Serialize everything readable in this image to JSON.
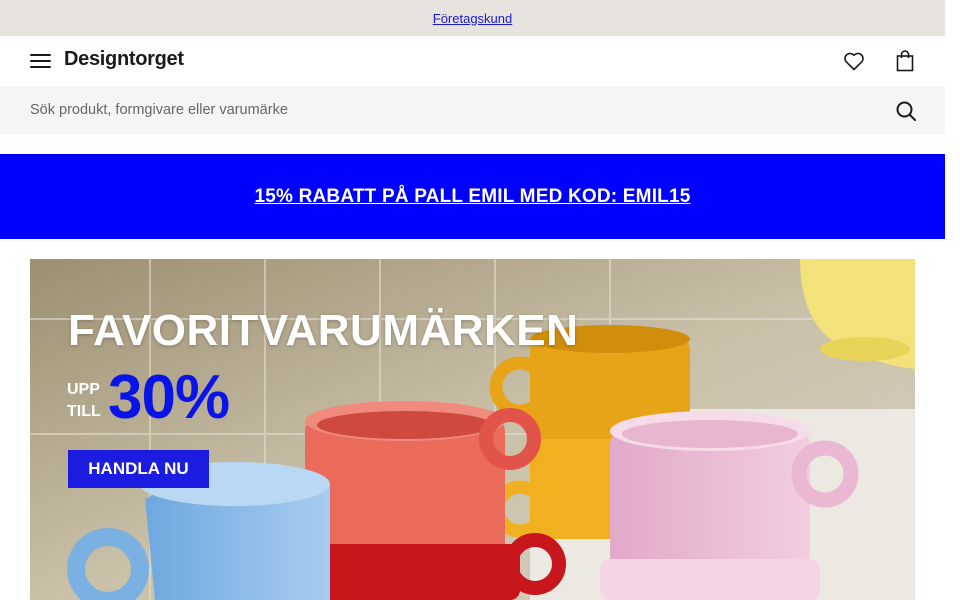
{
  "topbar": {
    "business_link": "Företagskund"
  },
  "header": {
    "logo": "Designtorget",
    "icons": {
      "menu": "menu-icon",
      "wishlist": "heart-icon",
      "cart": "shopping-bag-icon"
    }
  },
  "search": {
    "placeholder": "Sök produkt, formgivare eller varumärke",
    "icon": "search-icon"
  },
  "promo": {
    "text": "15% RABATT PÅ PALL EMIL MED KOD: EMIL15",
    "background": "#0000ff"
  },
  "hero": {
    "title": "FAVORITVARUMÄRKEN",
    "upto_line1": "UPP",
    "upto_line2": "TILL",
    "discount": "30%",
    "cta": "HANDLA NU",
    "accent": "#1c1ce0"
  }
}
